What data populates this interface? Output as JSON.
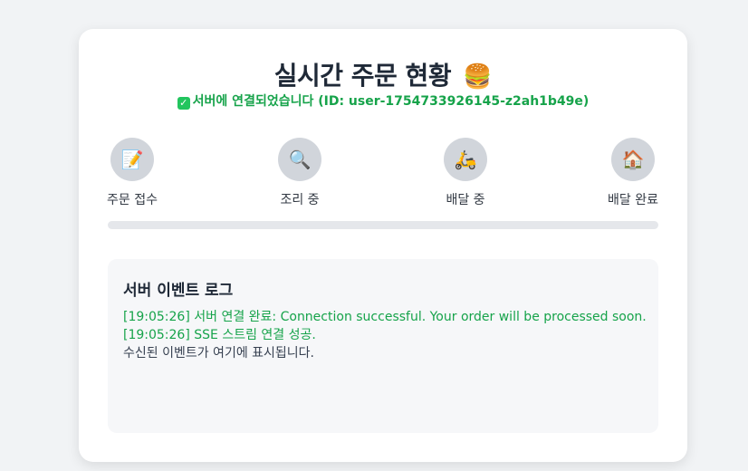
{
  "header": {
    "title": "실시간 주문 현황",
    "title_emoji": "🍔",
    "status_icon": "check-mark-icon",
    "status_text": "서버에 연결되었습니다 (ID: user-1754733926145-z2ah1b49e)"
  },
  "steps": [
    {
      "icon": "memo-icon",
      "glyph": "📝",
      "label": "주문 접수"
    },
    {
      "icon": "magnifier-icon",
      "glyph": "🔍",
      "label": "조리 중"
    },
    {
      "icon": "scooter-icon",
      "glyph": "🛵",
      "label": "배달 중"
    },
    {
      "icon": "house-icon",
      "glyph": "🏠",
      "label": "배달 완료"
    }
  ],
  "progress": {
    "percent": 0
  },
  "log": {
    "title": "서버 이벤트 로그",
    "lines": [
      {
        "text": "[19:05:26] 서버 연결 완료: Connection successful. Your order will be processed soon.",
        "type": "ok"
      },
      {
        "text": "[19:05:26] SSE 스트림 연결 성공.",
        "type": "ok"
      },
      {
        "text": "수신된 이벤트가 여기에 표시됩니다.",
        "type": "info"
      }
    ]
  },
  "colors": {
    "success": "#16a34a",
    "step_inactive": "#d1d5db",
    "track": "#e5e7eb"
  }
}
